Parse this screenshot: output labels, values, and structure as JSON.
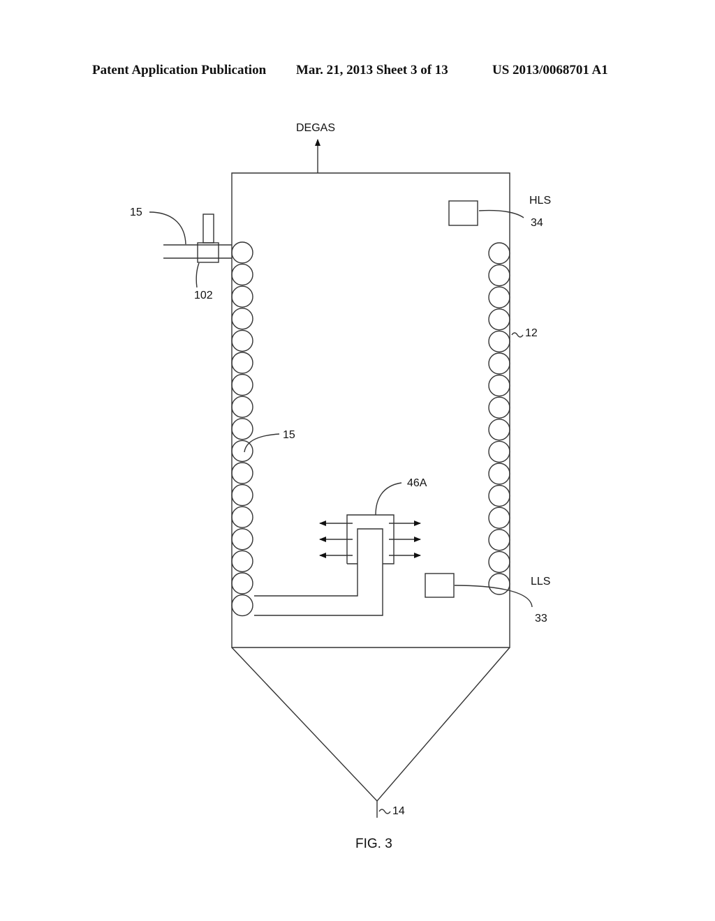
{
  "header": {
    "publication": "Patent Application Publication",
    "date_sheet": "Mar. 21, 2013  Sheet 3 of 13",
    "number": "US 2013/0068701 A1"
  },
  "figure": {
    "caption": "FIG. 3",
    "labels": {
      "degas": "DEGAS",
      "hls": "HLS",
      "lls": "LLS",
      "ref_15_pipe": "15",
      "ref_15_coil": "15",
      "ref_102": "102",
      "ref_34": "34",
      "ref_33": "33",
      "ref_12": "12",
      "ref_46a": "46A",
      "ref_14": "14"
    },
    "coils": {
      "left_count": 17,
      "right_count": 16
    },
    "emitter_arrows_per_side": 3
  }
}
